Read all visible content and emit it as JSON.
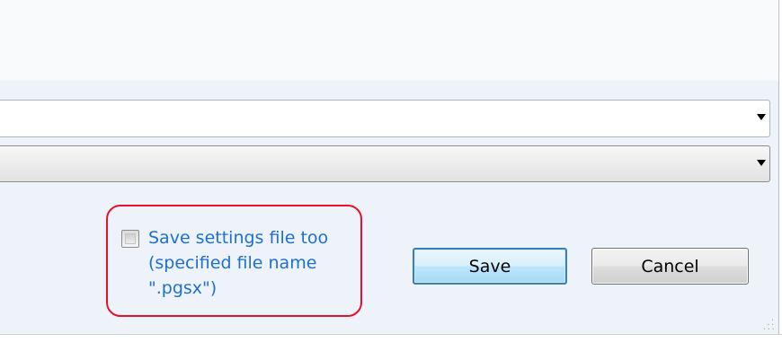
{
  "dialog": {
    "save_checkbox": {
      "checked": false,
      "label_lines": [
        "Save settings file too",
        "(specified file name",
        "\".pgsx\")"
      ]
    },
    "buttons": {
      "save_label": "Save",
      "cancel_label": "Cancel"
    },
    "filename_combo": {
      "value": ""
    },
    "type_combo": {
      "value": ""
    },
    "colors": {
      "accent_text": "#1e6fd4",
      "highlight_border": "#e8102e",
      "save_button_border": "#3c7fb1"
    },
    "icons": [
      "dropdown-arrow-icon",
      "resize-grip-icon"
    ]
  }
}
